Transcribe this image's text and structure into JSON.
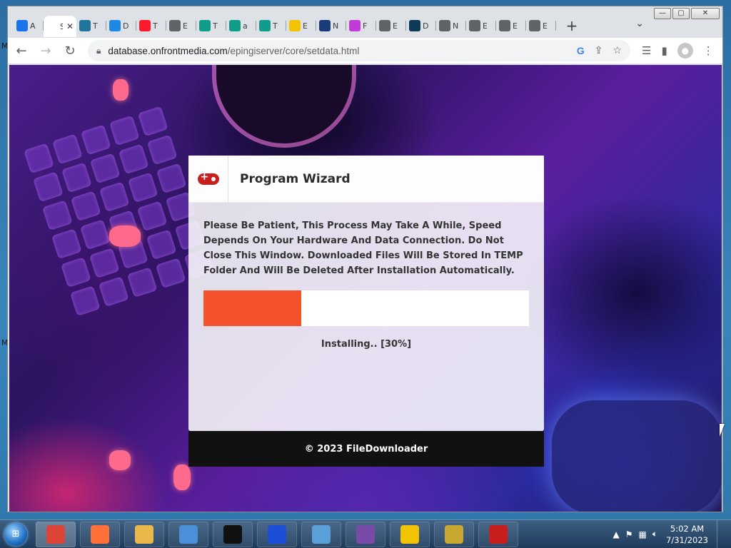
{
  "desktop": {
    "glyph_top": "M",
    "glyph_mid": "M"
  },
  "window": {
    "controls": {
      "minimize": "—",
      "maximize": "▢",
      "close": "✕"
    }
  },
  "tabs": [
    {
      "title": "A",
      "icon": "loading-icon",
      "color": "#1a73e8"
    },
    {
      "title": "S",
      "icon": "page-icon",
      "color": "#ffffff",
      "active": true
    },
    {
      "title": "T",
      "icon": "wordpress-icon",
      "color": "#21759b"
    },
    {
      "title": "D",
      "icon": "cloud-icon",
      "color": "#1e88e5"
    },
    {
      "title": "T",
      "icon": "opera-icon",
      "color": "#ff1b2d"
    },
    {
      "title": "E",
      "icon": "globe-icon",
      "color": "#5f6368"
    },
    {
      "title": "T",
      "icon": "play-icon",
      "color": "#0f9d8a"
    },
    {
      "title": "a",
      "icon": "play-icon",
      "color": "#0f9d8a"
    },
    {
      "title": "T",
      "icon": "play-icon",
      "color": "#0f9d8a"
    },
    {
      "title": "E",
      "icon": "check-icon",
      "color": "#f2c300"
    },
    {
      "title": "N",
      "icon": "globe-icon",
      "color": "#1a3d7a"
    },
    {
      "title": "F",
      "icon": "ai-icon",
      "color": "#c03bd8"
    },
    {
      "title": "E",
      "icon": "globe-icon",
      "color": "#5f6368"
    },
    {
      "title": "D",
      "icon": "s-icon",
      "color": "#0e3a5a"
    },
    {
      "title": "N",
      "icon": "chrome-icon",
      "color": "#5f6368"
    },
    {
      "title": "E",
      "icon": "globe-icon",
      "color": "#5f6368"
    },
    {
      "title": "E",
      "icon": "globe-icon",
      "color": "#5f6368"
    },
    {
      "title": "E",
      "icon": "globe-icon",
      "color": "#5f6368"
    }
  ],
  "toolbar": {
    "url_host": "database.onfrontmedia.com",
    "url_path": "/epingiserver/core/setdata.html"
  },
  "wizard": {
    "title": "Program Wizard",
    "message": "Please Be Patient, This Process May Take A While, Speed Depends On Your Hardware And Data Connection. Do Not Close This Window. Downloaded Files Will Be Stored In TEMP Folder And Will Be Deleted After Installation Automatically.",
    "progress_percent": 30,
    "progress_label": "Installing.. [30%]",
    "footer": "© 2023 FileDownloader",
    "accent_color": "#f4522d"
  },
  "taskbar": {
    "items": [
      {
        "name": "chrome",
        "color": "#db4437",
        "active": true
      },
      {
        "name": "firefox",
        "color": "#ff7139"
      },
      {
        "name": "explorer",
        "color": "#e8b84a"
      },
      {
        "name": "security",
        "color": "#4a8fd8"
      },
      {
        "name": "terminal",
        "color": "#111111"
      },
      {
        "name": "malwarebytes",
        "color": "#1c4ed8"
      },
      {
        "name": "installer",
        "color": "#5aa0d8"
      },
      {
        "name": "tool",
        "color": "#7a4aa8"
      },
      {
        "name": "puzzle",
        "color": "#f2c300"
      },
      {
        "name": "network",
        "color": "#c8a830"
      },
      {
        "name": "app",
        "color": "#c81e1e"
      }
    ],
    "time": "5:02 AM",
    "date": "7/31/2023"
  }
}
